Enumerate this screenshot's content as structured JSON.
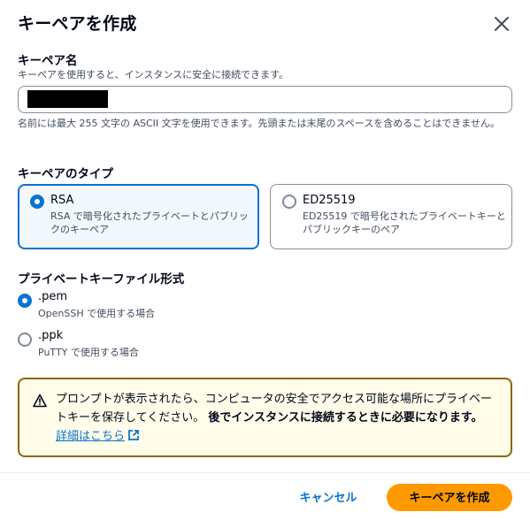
{
  "dialog": {
    "title": "キーペアを作成"
  },
  "name_field": {
    "label": "キーペア名",
    "description": "キーペアを使用すると、インスタンスに安全に接続できます。",
    "value": "",
    "hint": "名前には最大 255 文字の ASCII 文字を使用できます。先頭または末尾のスペースを含めることはできません。"
  },
  "key_type": {
    "label": "キーペアのタイプ",
    "options": [
      {
        "title": "RSA",
        "description": "RSA で暗号化されたプライベートとパブリックのキーペア",
        "selected": true
      },
      {
        "title": "ED25519",
        "description": "ED25519 で暗号化されたプライベートキーとパブリックキーのペア",
        "selected": false
      }
    ]
  },
  "file_format": {
    "label": "プライベートキーファイル形式",
    "options": [
      {
        "title": ".pem",
        "description": "OpenSSH で使用する場合",
        "selected": true
      },
      {
        "title": ".ppk",
        "description": "PuTTY で使用する場合",
        "selected": false
      }
    ]
  },
  "alert": {
    "icon": "warning-icon",
    "text_normal": "プロンプトが表示されたら、コンピュータの安全でアクセス可能な場所にプライベートキーを保存してください。",
    "text_bold": "後でインスタンスに接続するときに必要になります。",
    "link": "詳細はこちら"
  },
  "footer": {
    "cancel_label": "キャンセル",
    "create_label": "キーペアを作成"
  },
  "colors": {
    "accent": "#0972d3",
    "primary_button": "#ff9900",
    "warning_border": "#8d6605",
    "warning_bg": "#fffce9"
  }
}
